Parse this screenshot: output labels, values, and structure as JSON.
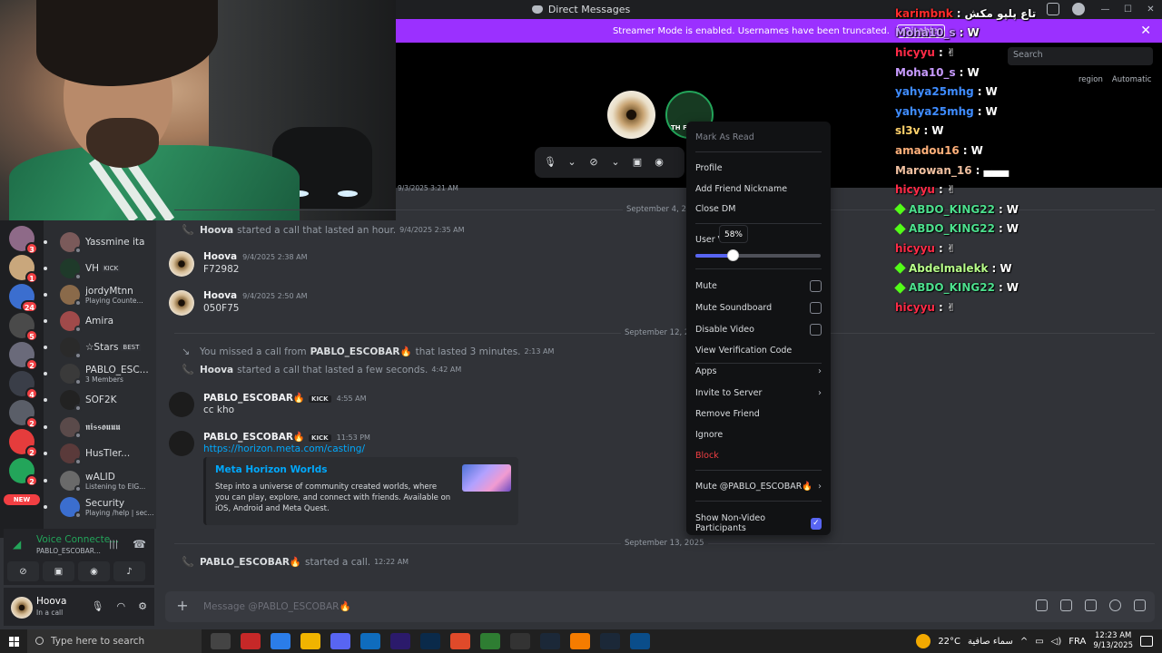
{
  "window": {
    "title": "Direct Messages"
  },
  "banner": {
    "text": "Streamer Mode is enabled. Usernames have been truncated.",
    "disable": "Disable"
  },
  "chat_overlay": [
    {
      "user": "karimbnk",
      "msg": "تاع پلپو مكش",
      "color": "#ff2b2b"
    },
    {
      "user": "Moha10_s",
      "msg": "W",
      "color": "#c89bff"
    },
    {
      "user": "hicyyu",
      "msg": "✌",
      "color": "#ff2b47"
    },
    {
      "user": "Moha10_s",
      "msg": "W",
      "color": "#c89bff"
    },
    {
      "user": "yahya25mhg",
      "msg": "W",
      "color": "#3f8cff"
    },
    {
      "user": "yahya25mhg",
      "msg": "W",
      "color": "#3f8cff"
    },
    {
      "user": "sl3v",
      "msg": "W",
      "color": "#ffd26b"
    },
    {
      "user": "amadou16",
      "msg": "W",
      "color": "#ffb07a"
    },
    {
      "user": "Marowan_16",
      "msg": "▄▄▄",
      "color": "#f0c0a0"
    },
    {
      "user": "hicyyu",
      "msg": "✌",
      "color": "#ff2b47"
    },
    {
      "user": "ABDO_KING22",
      "msg": "W",
      "color": "#4cdf8d",
      "badge": true
    },
    {
      "user": "ABDO_KING22",
      "msg": "W",
      "color": "#4cdf8d",
      "badge": true
    },
    {
      "user": "hicyyu",
      "msg": "✌",
      "color": "#ff2b47"
    },
    {
      "user": "Abdelmalekk",
      "msg": "W",
      "color": "#b8ff8a",
      "badge": true
    },
    {
      "user": "ABDO_KING22",
      "msg": "W",
      "color": "#4cdf8d",
      "badge": true
    },
    {
      "user": "hicyyu",
      "msg": "✌",
      "color": "#ff2b47"
    }
  ],
  "call": {
    "avatar2_label": "TH F"
  },
  "search": {
    "placeholder": "Search"
  },
  "region": {
    "label": "region",
    "value": "Automatic"
  },
  "servers": [
    {
      "badge": "3",
      "color": "#8e6a88"
    },
    {
      "badge": "1",
      "color": "#c9a77c"
    },
    {
      "badge": "24",
      "color": "#3b6ecf"
    },
    {
      "badge": "5",
      "color": "#4a4a4a"
    },
    {
      "badge": "2",
      "color": "#6a6a7a"
    },
    {
      "badge": "4",
      "color": "#3a3e48"
    },
    {
      "badge": "2",
      "color": "#5a5e68"
    },
    {
      "badge": "2",
      "color": "#e53c3c"
    },
    {
      "badge": "2",
      "color": "#23a55a"
    },
    {
      "badge": "NEW",
      "color": "#e4a11b"
    }
  ],
  "dms": [
    {
      "name": "Yassmine ita",
      "sub": "",
      "tag": "",
      "color": "#7a5a5a"
    },
    {
      "name": "VH",
      "sub": "",
      "tag": "KICK",
      "color": "#1f3a2a"
    },
    {
      "name": "jordyMtnn",
      "sub": "Playing Counte...",
      "tag": "",
      "color": "#8a6a4a"
    },
    {
      "name": "Amira",
      "sub": "",
      "tag": "",
      "color": "#a04a4a"
    },
    {
      "name": "☆Stars",
      "sub": "",
      "tag": "BEST",
      "color": "#2a2a2a"
    },
    {
      "name": "PABLO_ESC...",
      "sub": "3 Members",
      "tag": "",
      "color": "#3a3a3a"
    },
    {
      "name": "SOF2K",
      "sub": "",
      "tag": "",
      "color": "#222"
    },
    {
      "name": "𝖓𝖎𝖘𝖘𝖔𝖚𝖚𝖚",
      "sub": "",
      "tag": "",
      "color": "#5a4a4a"
    },
    {
      "name": "HusTler...",
      "sub": "",
      "tag": "",
      "color": "#5a3a3a"
    },
    {
      "name": "wALID",
      "sub": "Listening to EIG...",
      "tag": "",
      "color": "#6a6a6a"
    },
    {
      "name": "Security",
      "sub": "Playing /help | sec...",
      "tag": "",
      "color": "#3b6ecf"
    }
  ],
  "voice": {
    "title": "Voice Connecte...",
    "sub": "PABLO_ESCOBAR..."
  },
  "user": {
    "name": "Hoova",
    "status": "In a call"
  },
  "messages": {
    "top_ts": "9/3/2025 3:21 AM",
    "div1": "September 4, 2025",
    "sys1": {
      "who": "Hoova",
      "text": "started a call that lasted an hour.",
      "ts": "9/4/2025 2:35 AM"
    },
    "m1": {
      "author": "Hoova",
      "ts": "9/4/2025 2:38 AM",
      "body": "F72982"
    },
    "m2": {
      "author": "Hoova",
      "ts": "9/4/2025 2:50 AM",
      "body": "050F75"
    },
    "div2": "September 12, 2025",
    "sys2": {
      "pre": "You missed a call from",
      "who": "PABLO_ESCOBAR🔥",
      "text": "that lasted 3 minutes.",
      "ts": "2:13 AM"
    },
    "sys3": {
      "who": "Hoova",
      "text": "started a call that lasted a few seconds.",
      "ts": "4:42 AM"
    },
    "m3": {
      "author": "PABLO_ESCOBAR🔥",
      "tag": "KICK",
      "ts": "4:55 AM",
      "body": "cc kho"
    },
    "m4": {
      "author": "PABLO_ESCOBAR🔥",
      "tag": "KICK",
      "ts": "11:53 PM",
      "body": "https://horizon.meta.com/casting/"
    },
    "embed": {
      "title": "Meta Horizon Worlds",
      "desc": "Step into a universe of community created worlds, where you can play, explore, and connect with friends. Available on iOS, Android and Meta Quest."
    },
    "div3": "September 13, 2025",
    "sys4": {
      "who": "PABLO_ESCOBAR🔥",
      "text": "started a call.",
      "ts": "12:22 AM"
    }
  },
  "composer": {
    "placeholder": "Message @PABLO_ESCOBAR🔥"
  },
  "context_menu": {
    "mark_read": "Mark As Read",
    "profile": "Profile",
    "add_nick": "Add Friend Nickname",
    "close_dm": "Close DM",
    "user_volume": "User V",
    "volume_tip": "58%",
    "volume_level": 0.3,
    "mute": "Mute",
    "mute_soundboard": "Mute Soundboard",
    "disable_video": "Disable Video",
    "verification": "View Verification Code",
    "apps": "Apps",
    "invite": "Invite to Server",
    "remove_friend": "Remove Friend",
    "ignore": "Ignore",
    "block": "Block",
    "mute_user": "Mute @PABLO_ESCOBAR🔥",
    "show_nonvideo": "Show Non-Video Participants"
  },
  "taskbar": {
    "search": "Type here to search",
    "weather": "22°C",
    "weather_text": "سماء صافية",
    "lang": "FRA",
    "time": "12:23 AM",
    "date": "9/13/2025",
    "apps": [
      "#444",
      "#c62828",
      "#2b7de9",
      "#f0b400",
      "#5865f2",
      "#0f6cbd",
      "#2b1a6b",
      "#0a2a4a",
      "#e04a2a",
      "#2e7d32",
      "#333",
      "#1b2838",
      "#f57c00",
      "#1b2838",
      "#0a4d8a"
    ]
  }
}
